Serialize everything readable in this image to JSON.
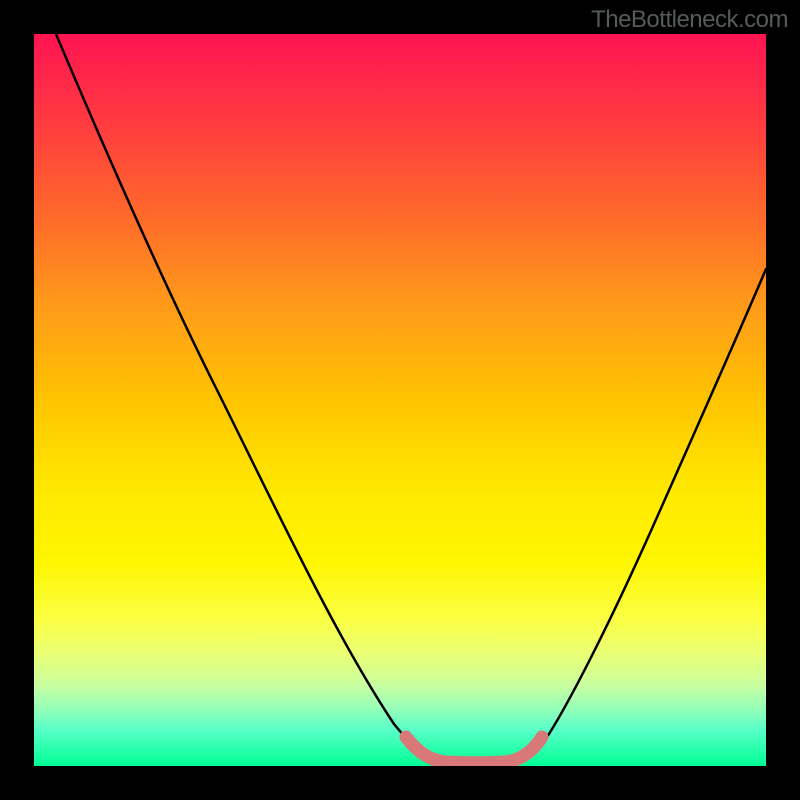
{
  "watermark": "TheBottleneck.com",
  "chart_data": {
    "type": "line",
    "title": "",
    "xlabel": "",
    "ylabel": "",
    "xlim": [
      0,
      100
    ],
    "ylim": [
      0,
      100
    ],
    "series": [
      {
        "name": "curve",
        "x": [
          3,
          10,
          20,
          30,
          40,
          48,
          52,
          55,
          58,
          61,
          64,
          67,
          70,
          75,
          82,
          90,
          100
        ],
        "y": [
          100,
          84,
          64,
          45,
          27,
          10,
          3,
          0.5,
          0,
          0,
          0,
          0.5,
          2,
          8,
          20,
          36,
          58
        ]
      },
      {
        "name": "valley-highlight",
        "x": [
          52,
          55,
          58,
          61,
          64,
          67
        ],
        "y": [
          3,
          0.5,
          0,
          0,
          0.5,
          3
        ]
      }
    ],
    "colors": {
      "curve": "#000000",
      "valley": "#d97878",
      "gradient_top": "#ff1452",
      "gradient_bottom": "#00ff94",
      "frame": "#000000"
    }
  }
}
